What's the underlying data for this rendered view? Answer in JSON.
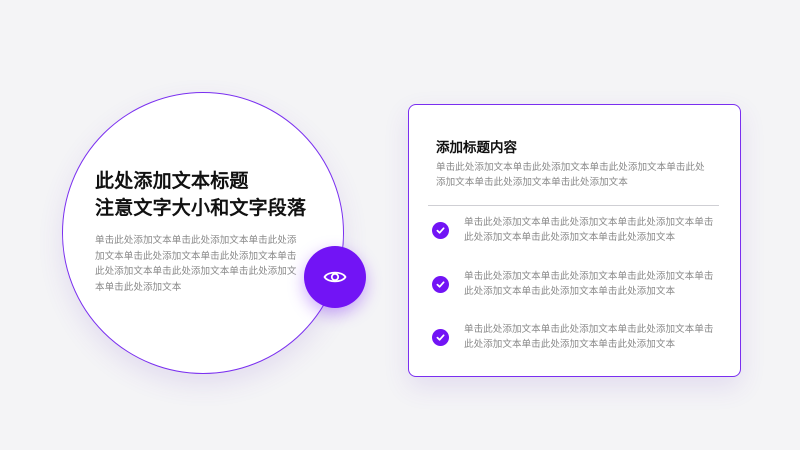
{
  "colors": {
    "accent": "#7214f5",
    "border": "#7a2ff0",
    "background": "#f4f4f6",
    "heading": "#111111",
    "body_text": "#8a8a8a",
    "divider": "#cfcfd4"
  },
  "left_section": {
    "title_line1": "此处添加文本标题",
    "title_line2": "注意文字大小和文字段落",
    "body": "单击此处添加文本单击此处添加文本单击此处添加文本单击此处添加文本单击此处添加文本单击此处添加文本单击此处添加文本单击此处添加文本单击此处添加文本",
    "badge_icon": "eye-icon"
  },
  "right_card": {
    "title": "添加标题内容",
    "description": "单击此处添加文本单击此处添加文本单击此处添加文本单击此处添加文本单击此处添加文本单击此处添加文本",
    "items": [
      {
        "icon": "check-circle-icon",
        "text": "单击此处添加文本单击此处添加文本单击此处添加文本单击此处添加文本单击此处添加文本单击此处添加文本"
      },
      {
        "icon": "check-circle-icon",
        "text": "单击此处添加文本单击此处添加文本单击此处添加文本单击此处添加文本单击此处添加文本单击此处添加文本"
      },
      {
        "icon": "check-circle-icon",
        "text": "单击此处添加文本单击此处添加文本单击此处添加文本单击此处添加文本单击此处添加文本单击此处添加文本"
      }
    ]
  }
}
